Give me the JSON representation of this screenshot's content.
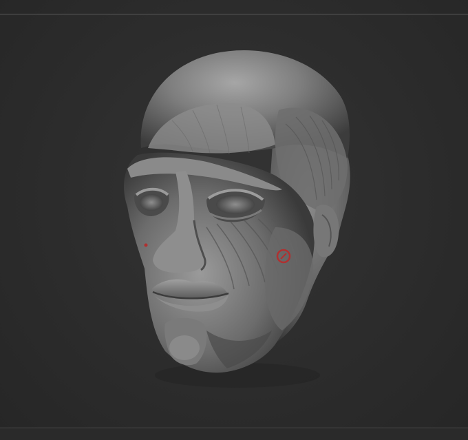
{
  "viewport": {
    "background_color": "#2c2c2c",
    "frame_line_color": "#5a5a5a"
  },
  "model": {
    "icon": "sculpted-head-model",
    "base_color": "#7a7a7a",
    "markers": [
      {
        "name": "red-marker-jaw",
        "color": "#b03030"
      },
      {
        "name": "red-marker-nose",
        "color": "#b03030"
      }
    ]
  }
}
